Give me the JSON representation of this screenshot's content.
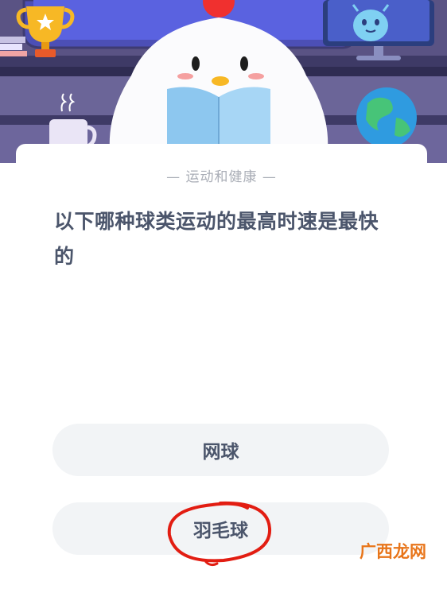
{
  "quiz": {
    "category": "— 运动和健康 —",
    "question": "以下哪种球类运动的最高时速是最快的",
    "options": [
      {
        "label": "网球"
      },
      {
        "label": "羽毛球",
        "highlighted": true
      }
    ]
  },
  "watermark": "广西龙网",
  "colors": {
    "hero_background": "#5a5384",
    "card_background": "#ffffff",
    "option_background": "#f2f4f6",
    "text_primary": "#4b556b",
    "text_secondary": "#a9adb6",
    "highlight_circle": "#e21d12",
    "watermark": "#e8751a"
  },
  "icons": [
    "trophy-icon",
    "mug-icon",
    "chick-mascot-icon",
    "open-book-icon",
    "monitor-icon",
    "alien-icon",
    "globe-icon"
  ]
}
